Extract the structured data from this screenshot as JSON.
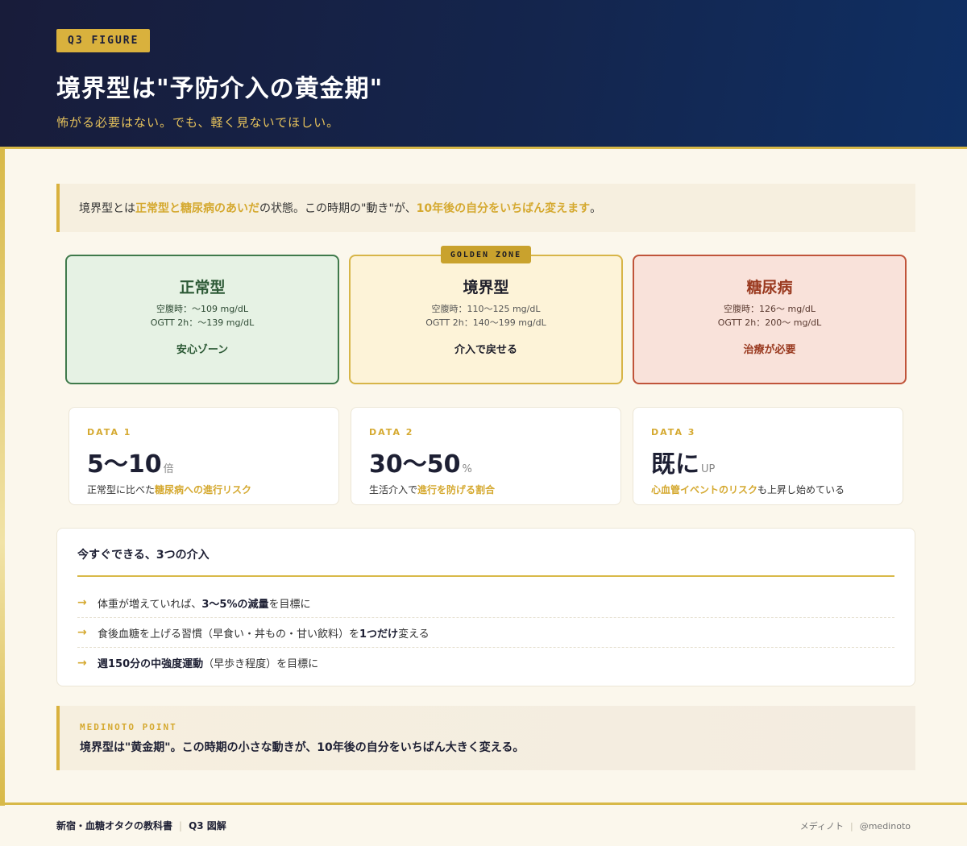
{
  "header": {
    "badge": "Q3 FIGURE",
    "title": "境界型は\"予防介入の黄金期\"",
    "subtitle": "怖がる必要はない。でも、軽く見ないでほしい。"
  },
  "intro": {
    "part1": "境界型とは",
    "highlight1": "正常型と糖尿病のあいだ",
    "part2": "の状態。この時期の\"動き\"が、",
    "highlight2": "10年後の自分をいちばん変えます",
    "part3": "。"
  },
  "zones": [
    {
      "name": "正常型",
      "line1": "空腹時：〜109 mg/dL",
      "line2": "OGTT 2h：〜139 mg/dL",
      "note": "安心ゾーン"
    },
    {
      "name": "境界型",
      "line1": "空腹時：110〜125 mg/dL",
      "line2": "OGTT 2h：140〜199 mg/dL",
      "note": "介入で戻せる",
      "tag": "GOLDEN ZONE"
    },
    {
      "name": "糖尿病",
      "line1": "空腹時：126〜 mg/dL",
      "line2": "OGTT 2h：200〜 mg/dL",
      "note": "治療が必要"
    }
  ],
  "stats": [
    {
      "label": "DATA 1",
      "value": "5〜10",
      "unit": "倍",
      "desc_pre": "正常型に比べた",
      "desc_hl": "糖尿病への進行リスク",
      "desc_post": ""
    },
    {
      "label": "DATA 2",
      "value": "30〜50",
      "unit": "%",
      "desc_pre": "生活介入で",
      "desc_hl": "進行を防げる割合",
      "desc_post": ""
    },
    {
      "label": "DATA 3",
      "value": "既に",
      "unit": "UP",
      "desc_pre": "",
      "desc_hl": "心血管イベントのリスク",
      "desc_post": "も上昇し始めている"
    }
  ],
  "actions": {
    "heading": "今すぐできる、3つの介入",
    "items": [
      {
        "pre": "体重が増えていれば、",
        "bold": "3〜5%の減量",
        "post": "を目標に"
      },
      {
        "pre": "食後血糖を上げる習慣（早食い・丼もの・甘い飲料）を",
        "bold": "1つだけ",
        "post": "変える"
      },
      {
        "pre": "",
        "bold": "週150分の中強度運動",
        "post": "（早歩き程度）を目標に"
      }
    ]
  },
  "point": {
    "label": "MEDINOTO POINT",
    "text": "境界型は\"黄金期\"。この時期の小さな動きが、10年後の自分をいちばん大きく変える。"
  },
  "footer": {
    "left1": "新宿・血糖オタクの教科書",
    "left2": "Q3 図解",
    "right1": "メディノト",
    "right2": "@medinoto"
  },
  "colors": {
    "navy": "#14254d",
    "gold": "#d9b13d",
    "normal": "#3f7a4b",
    "diabetes": "#c0543a"
  }
}
